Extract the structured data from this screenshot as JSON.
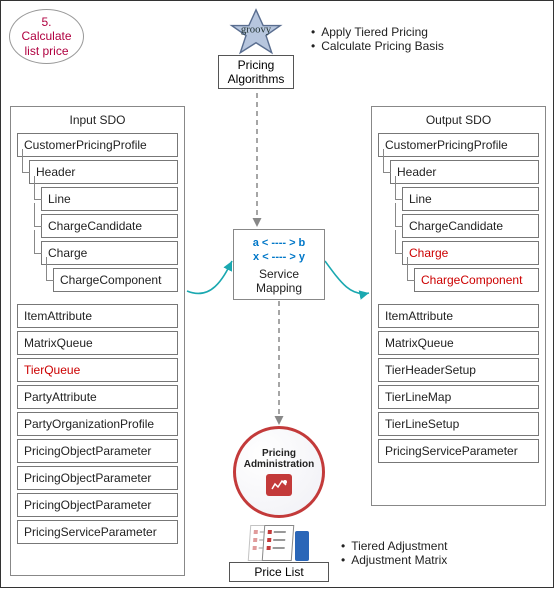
{
  "step": {
    "number": "5.",
    "label": "Calculate\nlist price"
  },
  "algorithms": {
    "label": "Pricing\nAlgorithms",
    "script_name": "groovy",
    "bullets": [
      "Apply Tiered Pricing",
      "Calculate Pricing Basis"
    ]
  },
  "service_mapping": {
    "line1": "a < ---- > b",
    "line2": "x < ---- > y",
    "label": "Service\nMapping"
  },
  "pricing_admin": {
    "label": "Pricing\nAdministration"
  },
  "price_list": {
    "label": "Price List",
    "bullets": [
      "Tiered Adjustment",
      "Adjustment Matrix"
    ]
  },
  "input_sdo": {
    "title": "Input SDO",
    "top_rows": [
      {
        "label": "CustomerPricingProfile",
        "indent": 0
      },
      {
        "label": "Header",
        "indent": 1
      },
      {
        "label": "Line",
        "indent": 2
      },
      {
        "label": "ChargeCandidate",
        "indent": 2
      },
      {
        "label": "Charge",
        "indent": 2
      },
      {
        "label": "ChargeComponent",
        "indent": 3
      }
    ],
    "bottom_rows": [
      {
        "label": "ItemAttribute"
      },
      {
        "label": "MatrixQueue"
      },
      {
        "label": "TierQueue",
        "red": true
      },
      {
        "label": "PartyAttribute"
      },
      {
        "label": "PartyOrganizationProfile"
      },
      {
        "label": "PricingObjectParameter"
      },
      {
        "label": "PricingObjectParameter"
      },
      {
        "label": "PricingObjectParameter"
      },
      {
        "label": "PricingServiceParameter"
      }
    ]
  },
  "output_sdo": {
    "title": "Output SDO",
    "top_rows": [
      {
        "label": "CustomerPricingProfile",
        "indent": 0
      },
      {
        "label": "Header",
        "indent": 1
      },
      {
        "label": "Line",
        "indent": 2
      },
      {
        "label": "ChargeCandidate",
        "indent": 2
      },
      {
        "label": "Charge",
        "indent": 2,
        "red": true
      },
      {
        "label": "ChargeComponent",
        "indent": 3,
        "red": true
      }
    ],
    "bottom_rows": [
      {
        "label": "ItemAttribute"
      },
      {
        "label": "MatrixQueue"
      },
      {
        "label": "TierHeaderSetup"
      },
      {
        "label": "TierLineMap"
      },
      {
        "label": "TierLineSetup"
      },
      {
        "label": "PricingServiceParameter"
      }
    ]
  }
}
